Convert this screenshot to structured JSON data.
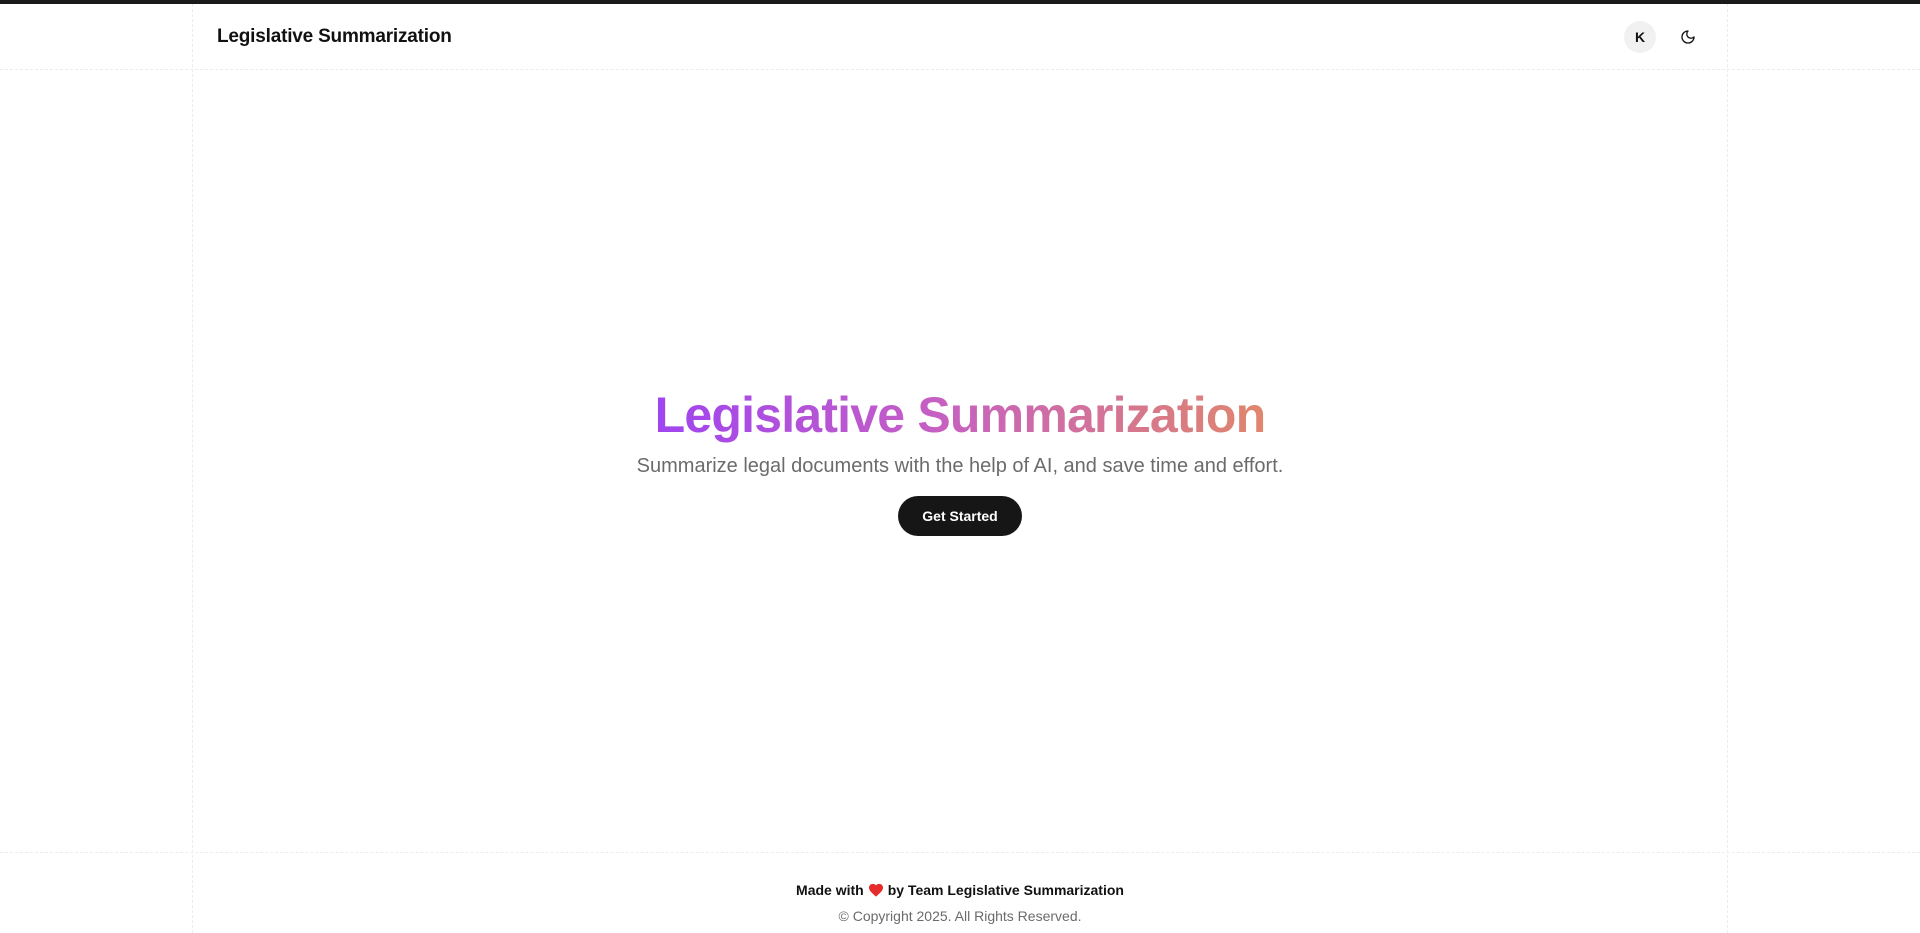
{
  "header": {
    "brand": "Legislative Summarization",
    "avatar_initial": "K",
    "theme_toggle_icon": "moon-icon"
  },
  "hero": {
    "title": "Legislative Summarization",
    "subtitle": "Summarize legal documents with the help of AI, and save time and effort.",
    "cta_label": "Get Started"
  },
  "footer": {
    "made_with_prefix": "Made with",
    "heart_icon": "heart-icon",
    "made_with_suffix": "by Team Legislative Summarization",
    "copyright": "© Copyright 2025. All Rights Reserved."
  },
  "colors": {
    "gradient_start": "#a044f0",
    "gradient_end": "#e0866c",
    "cta_background": "#161616",
    "heart": "#e52b2b"
  }
}
